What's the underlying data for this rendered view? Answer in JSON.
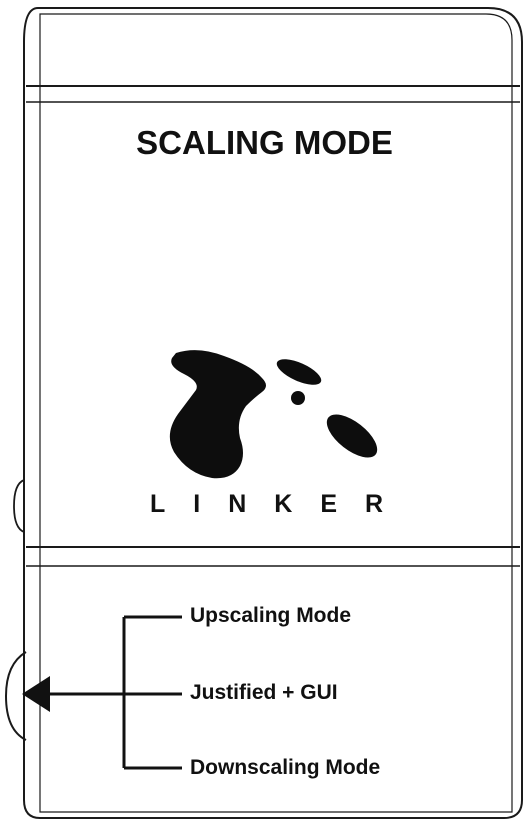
{
  "header": {
    "title": "SCALING MODE"
  },
  "logo": {
    "name": "linker-logo",
    "text": "LINKER"
  },
  "switch": {
    "modes": [
      {
        "label": "Upscaling Mode"
      },
      {
        "label": "Justified + GUI"
      },
      {
        "label": "Downscaling Mode"
      }
    ]
  },
  "colors": {
    "line": "#111111",
    "background": "#ffffff"
  }
}
